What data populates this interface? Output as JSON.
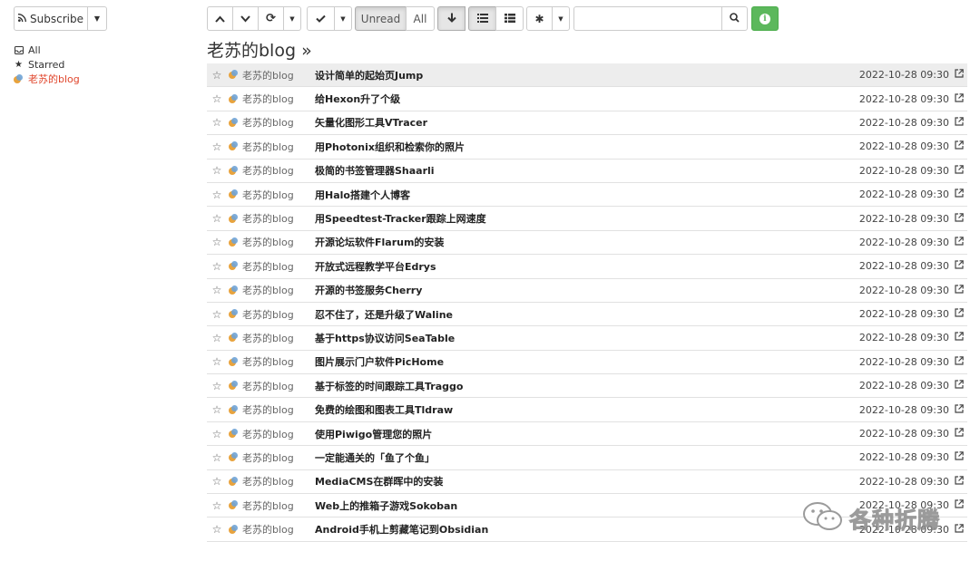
{
  "sidebar": {
    "subscribe_label": "Subscribe",
    "nav": [
      {
        "label": "All",
        "icon": "inbox-icon"
      },
      {
        "label": "Starred",
        "icon": "star-icon"
      },
      {
        "label": "老苏的blog",
        "icon": "feed-favicon"
      }
    ]
  },
  "toolbar": {
    "unread_label": "Unread",
    "all_label": "All",
    "search_placeholder": "",
    "active_filter": "Unread",
    "accent_green": "#5cb85c"
  },
  "feed": {
    "title": "老苏的blog »",
    "entries": [
      {
        "source": "老苏的blog",
        "title": "设计简单的起始页Jump",
        "date": "2022-10-28 09:30"
      },
      {
        "source": "老苏的blog",
        "title": "给Hexon升了个级",
        "date": "2022-10-28 09:30"
      },
      {
        "source": "老苏的blog",
        "title": "矢量化图形工具VTracer",
        "date": "2022-10-28 09:30"
      },
      {
        "source": "老苏的blog",
        "title": "用Photonix组织和检索你的照片",
        "date": "2022-10-28 09:30"
      },
      {
        "source": "老苏的blog",
        "title": "极简的书签管理器Shaarli",
        "date": "2022-10-28 09:30"
      },
      {
        "source": "老苏的blog",
        "title": "用Halo搭建个人博客",
        "date": "2022-10-28 09:30"
      },
      {
        "source": "老苏的blog",
        "title": "用Speedtest-Tracker跟踪上网速度",
        "date": "2022-10-28 09:30"
      },
      {
        "source": "老苏的blog",
        "title": "开源论坛软件Flarum的安装",
        "date": "2022-10-28 09:30"
      },
      {
        "source": "老苏的blog",
        "title": "开放式远程教学平台Edrys",
        "date": "2022-10-28 09:30"
      },
      {
        "source": "老苏的blog",
        "title": "开源的书签服务Cherry",
        "date": "2022-10-28 09:30"
      },
      {
        "source": "老苏的blog",
        "title": "忍不住了，还是升级了Waline",
        "date": "2022-10-28 09:30"
      },
      {
        "source": "老苏的blog",
        "title": "基于https协议访问SeaTable",
        "date": "2022-10-28 09:30"
      },
      {
        "source": "老苏的blog",
        "title": "图片展示门户软件PicHome",
        "date": "2022-10-28 09:30"
      },
      {
        "source": "老苏的blog",
        "title": "基于标签的时间跟踪工具Traggo",
        "date": "2022-10-28 09:30"
      },
      {
        "source": "老苏的blog",
        "title": "免费的绘图和图表工具Tldraw",
        "date": "2022-10-28 09:30"
      },
      {
        "source": "老苏的blog",
        "title": "使用Piwigo管理您的照片",
        "date": "2022-10-28 09:30"
      },
      {
        "source": "老苏的blog",
        "title": "一定能通关的「鱼了个鱼」",
        "date": "2022-10-28 09:30"
      },
      {
        "source": "老苏的blog",
        "title": "MediaCMS在群晖中的安装",
        "date": "2022-10-28 09:30"
      },
      {
        "source": "老苏的blog",
        "title": "Web上的推箱子游戏Sokoban",
        "date": "2022-10-28 09:30"
      },
      {
        "source": "老苏的blog",
        "title": "Android手机上剪藏笔记到Obsidian",
        "date": "2022-10-28 09:30"
      }
    ]
  },
  "watermark": {
    "text": "各种折腾"
  }
}
